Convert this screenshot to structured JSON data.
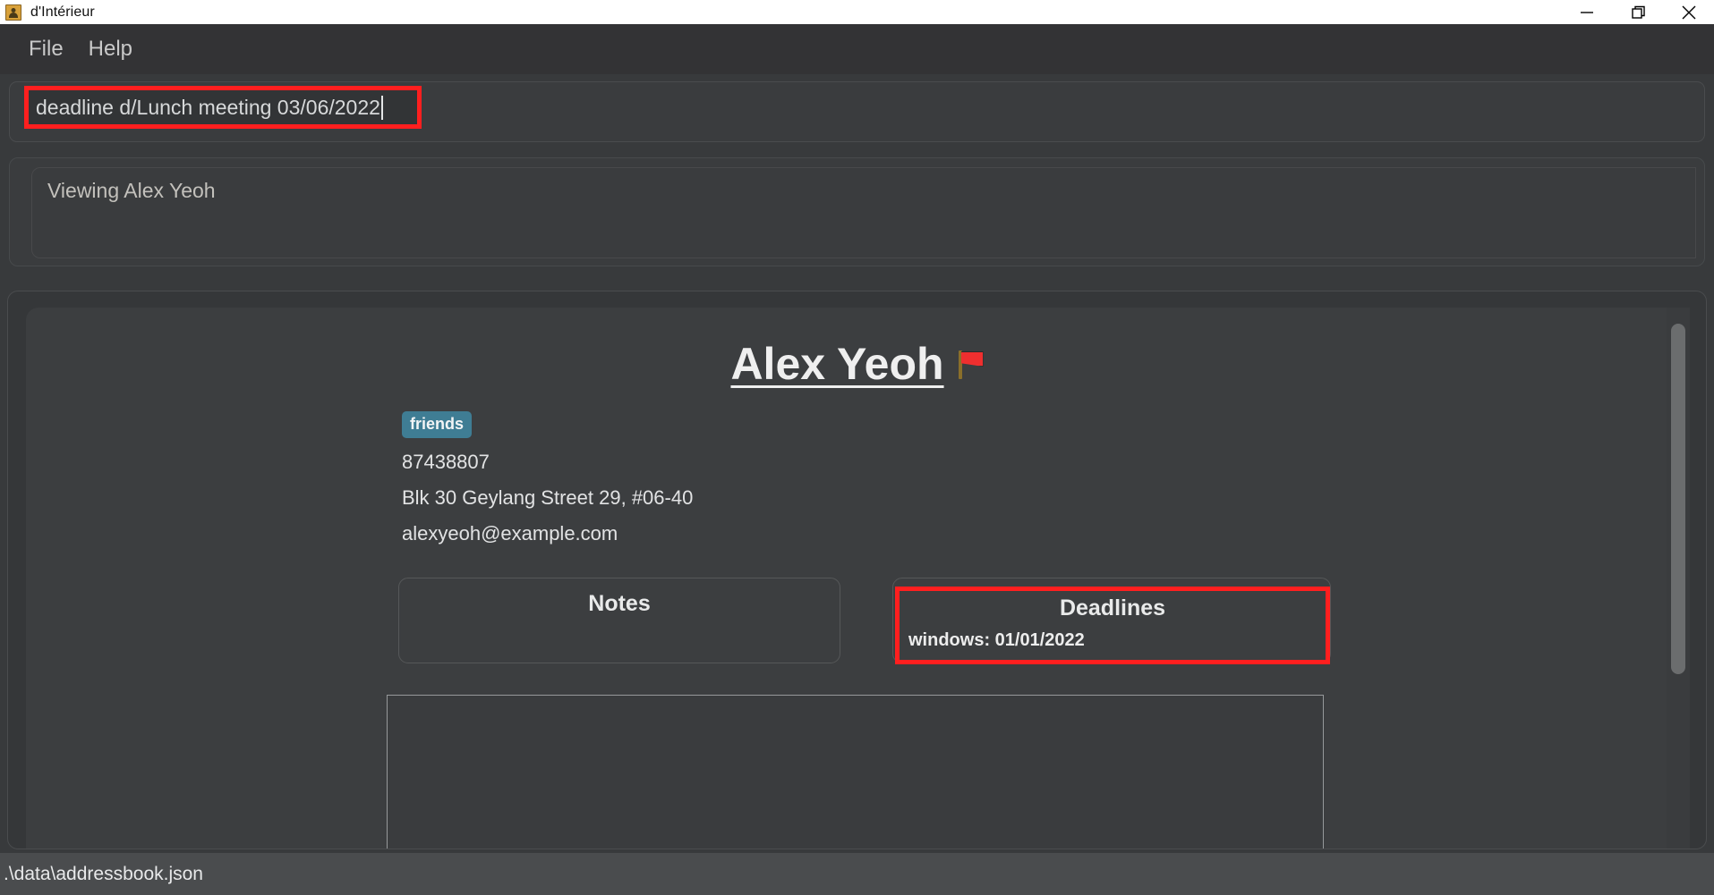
{
  "window": {
    "title": "d'Intérieur",
    "icon": "address-book-icon",
    "controls": {
      "minimize": "minimize-icon",
      "restore": "restore-icon",
      "close": "close-icon"
    }
  },
  "menubar": {
    "items": [
      {
        "label": "File"
      },
      {
        "label": "Help"
      }
    ]
  },
  "command": {
    "value": "deadline d/Lunch meeting 03/06/2022",
    "placeholder": "Enter command here...",
    "highlight_color": "#ff1f1f"
  },
  "result": {
    "text": "Viewing Alex Yeoh"
  },
  "person": {
    "name": "Alex Yeoh",
    "flag": "red-flag-icon",
    "tags": [
      "friends"
    ],
    "phone": "87438807",
    "address": "Blk 30 Geylang Street 29, #06-40",
    "email": "alexyeoh@example.com",
    "tag_color": "#3f7d94"
  },
  "notes": {
    "title": "Notes",
    "entries": []
  },
  "deadlines": {
    "title": "Deadlines",
    "entries": [
      {
        "label": "windows",
        "date": "01/01/2022",
        "text": "windows: 01/01/2022"
      }
    ],
    "highlight_color": "#ff1f1f"
  },
  "statusbar": {
    "path": ".\\data\\addressbook.json"
  }
}
